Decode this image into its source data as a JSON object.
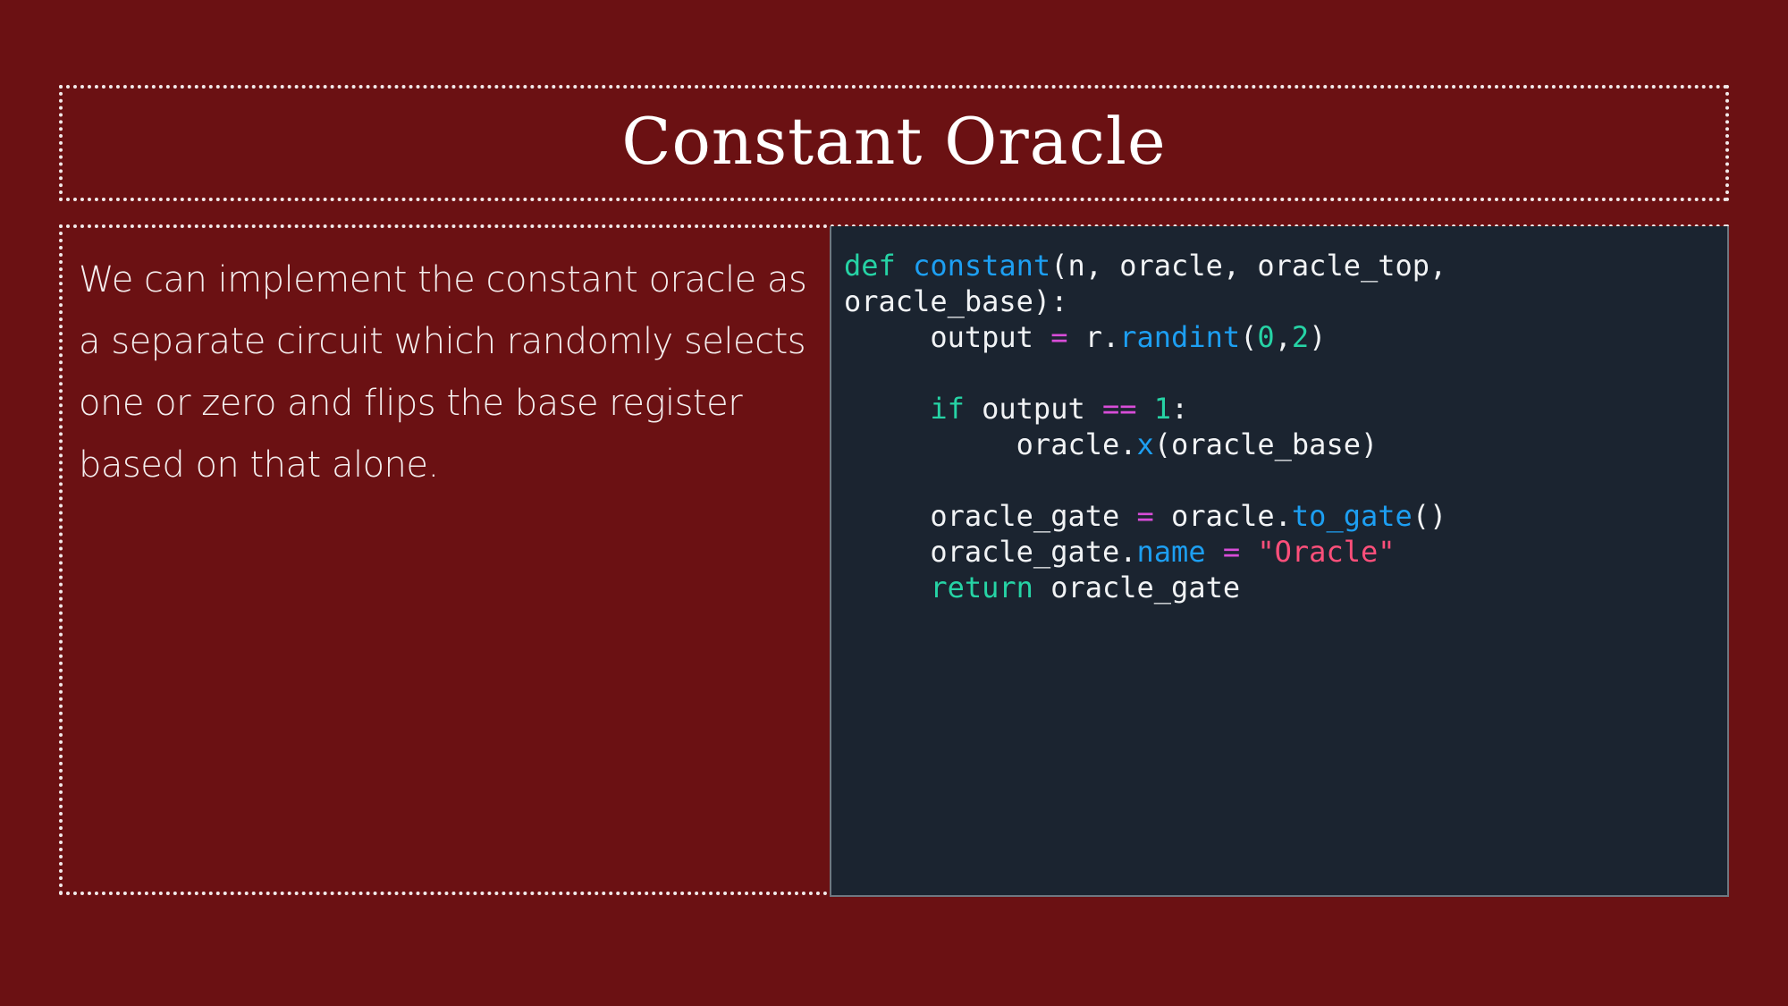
{
  "slide": {
    "title": "Constant Oracle",
    "body_text": "We can implement the constant oracle as a separate circuit which randomly selects one or zero and flips the base register based on that alone."
  },
  "code": {
    "line1": {
      "kw_def": "def",
      "func_name": "constant",
      "params": "(n, oracle, oracle_top,"
    },
    "line2": {
      "cont": "oracle_base):"
    },
    "line3": {
      "var": "output",
      "op_eq": "=",
      "obj": "r.",
      "method": "randint",
      "open": "(",
      "arg0": "0",
      "comma": ",",
      "arg1": "2",
      "close": ")"
    },
    "line5": {
      "kw_if": "if",
      "var": "output",
      "op_eqeq": "==",
      "num": "1",
      "colon": ":"
    },
    "line6": {
      "obj": "oracle.",
      "method": "x",
      "args": "(oracle_base)"
    },
    "line8": {
      "var": "oracle_gate",
      "op_eq": "=",
      "obj": "oracle.",
      "method": "to_gate",
      "args": "()"
    },
    "line9": {
      "obj": "oracle_gate.",
      "attr": "name",
      "op_eq": "=",
      "str": "\"Oracle\""
    },
    "line10": {
      "kw_return": "return",
      "var": "oracle_gate"
    }
  },
  "colors": {
    "background": "#6b1113",
    "code_background": "#1b2430",
    "keyword": "#26d3a5",
    "function": "#1d9ff2",
    "operator": "#d84dd8",
    "string": "#ff4f7a"
  }
}
